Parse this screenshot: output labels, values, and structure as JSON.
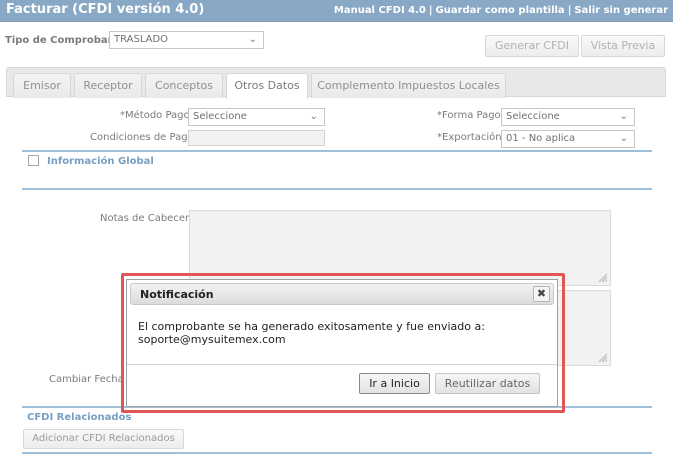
{
  "titlebar": {
    "title": "Facturar (CFDI versión 4.0)",
    "links": [
      "Manual CFDI 4.0",
      "Guardar como plantilla",
      "Salir sin generar"
    ],
    "separator": "|",
    "color": "#4a7aa6"
  },
  "toolbar": {
    "tipo_label": "Tipo de Comprobante:",
    "tipo_value": "TRASLADO",
    "generar_label": "Generar CFDI",
    "vista_label": "Vista Previa"
  },
  "tabs": [
    {
      "label": "Emisor",
      "active": false
    },
    {
      "label": "Receptor",
      "active": false
    },
    {
      "label": "Conceptos",
      "active": false
    },
    {
      "label": "Otros Datos",
      "active": true
    },
    {
      "label": "Complemento Impuestos Locales",
      "active": false
    }
  ],
  "form": {
    "metodo_label": "*Método Pago:",
    "metodo_value": "Seleccione",
    "forma_label": "*Forma Pago:",
    "forma_value": "Seleccione",
    "condiciones_label": "Condiciones de Pago:",
    "exportacion_label": "*Exportación:",
    "exportacion_value": "01 - No aplica",
    "info_global_label": "Información Global",
    "notas_label": "Notas de Cabecera:",
    "cambiar_fecha_label": "Cambiar Fecha d",
    "cfdi_relacionados_label": "CFDI Relacionados",
    "adicionar_label": "Adicionar CFDI Relacionados"
  },
  "dialog": {
    "title": "Notificación",
    "close_glyph": "✖",
    "message_line1": "El comprobante se ha generado exitosamente y fue enviado a:",
    "message_line2": "soporte@mysuitemex.com",
    "primary_button": "Ir a Inicio",
    "secondary_button": "Reutilizar datos",
    "highlight_color": "#e05656"
  }
}
